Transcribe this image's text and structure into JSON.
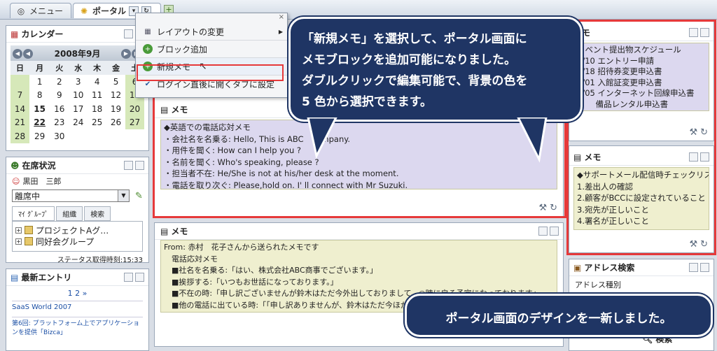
{
  "tabs": [
    {
      "label": "メニュー",
      "icon": "globe-icon"
    },
    {
      "label": "ポータル",
      "icon": "sun-icon"
    }
  ],
  "menu": {
    "items": [
      {
        "label": "レイアウトの変更",
        "icon": "layout-icon"
      },
      {
        "label": "ブロック追加",
        "icon": "plus-circle-icon"
      },
      {
        "label": "新規メモ",
        "icon": "plus-circle-icon"
      },
      {
        "label": "ログイン直後に開くタブに設定",
        "icon": "check-icon"
      }
    ]
  },
  "calendar": {
    "title": "カレンダー",
    "month": "2008年9月",
    "weekdays": [
      "日",
      "月",
      "火",
      "水",
      "木",
      "金",
      "土"
    ],
    "weeks": [
      [
        "",
        "1",
        "2",
        "3",
        "4",
        "5",
        "6"
      ],
      [
        "7",
        "8",
        "9",
        "10",
        "11",
        "12",
        "13"
      ],
      [
        "14",
        "15",
        "16",
        "17",
        "18",
        "19",
        "20"
      ],
      [
        "21",
        "22",
        "23",
        "24",
        "25",
        "26",
        "27"
      ],
      [
        "28",
        "29",
        "30",
        "",
        "",
        "",
        ""
      ]
    ]
  },
  "presence": {
    "title": "在席状況",
    "user": "黒田　三郎",
    "status": "離席中",
    "tabs": [
      "ﾏｲ ｸﾞﾙｰﾌﾟ",
      "組織",
      "検索"
    ],
    "groups": [
      "プロジェクトAグ…",
      "同好会グループ"
    ],
    "timestamp": "ステータス取得時刻:15:33"
  },
  "entries": {
    "title": "最新エントリ",
    "pages": "1 2 »",
    "items": [
      "SaaS World 2007",
      "第6回: プラットフォーム上でアプリケーションを提供「Bizca」"
    ]
  },
  "memo1": {
    "title": "メモ",
    "lines": [
      "◆英語での電話応対メモ",
      "・会社名を名乗る: Hello, This is ABC　company.",
      "・用件を聞く:  How can I help you ?",
      "・名前を聞く:  Who's speaking, please ?",
      "・担当者不在:  He/She is not at his/her desk at the moment.",
      "・電話を取り次ぐ:  Please,hold on. I' ll connect with Mr Suzuki."
    ]
  },
  "memo2": {
    "title": "メモ",
    "lines": [
      "From: 赤村　花子さんから送られたメモです",
      "　電話応対メモ",
      "　■社名を名乗る:「はい、株式会社ABC商事でございます。」",
      "　■挨拶する:「いつもお世話になっております。」",
      "　■不在の時:「申し訳ございませんが鈴木はただ今外出しておりまして、○時に戻る予定になっております」",
      "　■他の電話に出ている時:「「申し訳ありませんが、鈴木はただ今ほかの"
    ]
  },
  "right_memo1": {
    "title": "メモ",
    "lines": [
      "イベント提出物スケジュール",
      "9/10 エントリー申請",
      "9/18 招待券変更申込書",
      "9/01 入館証変更申込書",
      "9/05 インターネット回線申込書",
      "　　 備品レンタル申込書"
    ]
  },
  "right_memo2": {
    "title": "メモ",
    "lines": [
      "◆サポートメール配信時チェックリスト",
      "1.差出人の確認",
      "2.顧客がBCCに設定されていること",
      "3.宛先が正しいこと",
      "4.署名が正しいこと"
    ]
  },
  "address": {
    "title": "アドレス検索",
    "label": "アドレス種別",
    "search": "検索"
  },
  "callouts": {
    "top": [
      "「新規メモ」を選択して、ポータル画面に",
      "メモブロックを追加可能になりました。",
      "ダブルクリックで編集可能で、背景の色を",
      "5 色から選択できます。"
    ],
    "bottom": "ポータル画面のデザインを一新しました。"
  },
  "colors": {
    "memo_purple": "#dcd8ef",
    "memo_yellow": "#efefcf",
    "highlight_red": "#e6393a",
    "callout_navy": "#1f3564"
  }
}
